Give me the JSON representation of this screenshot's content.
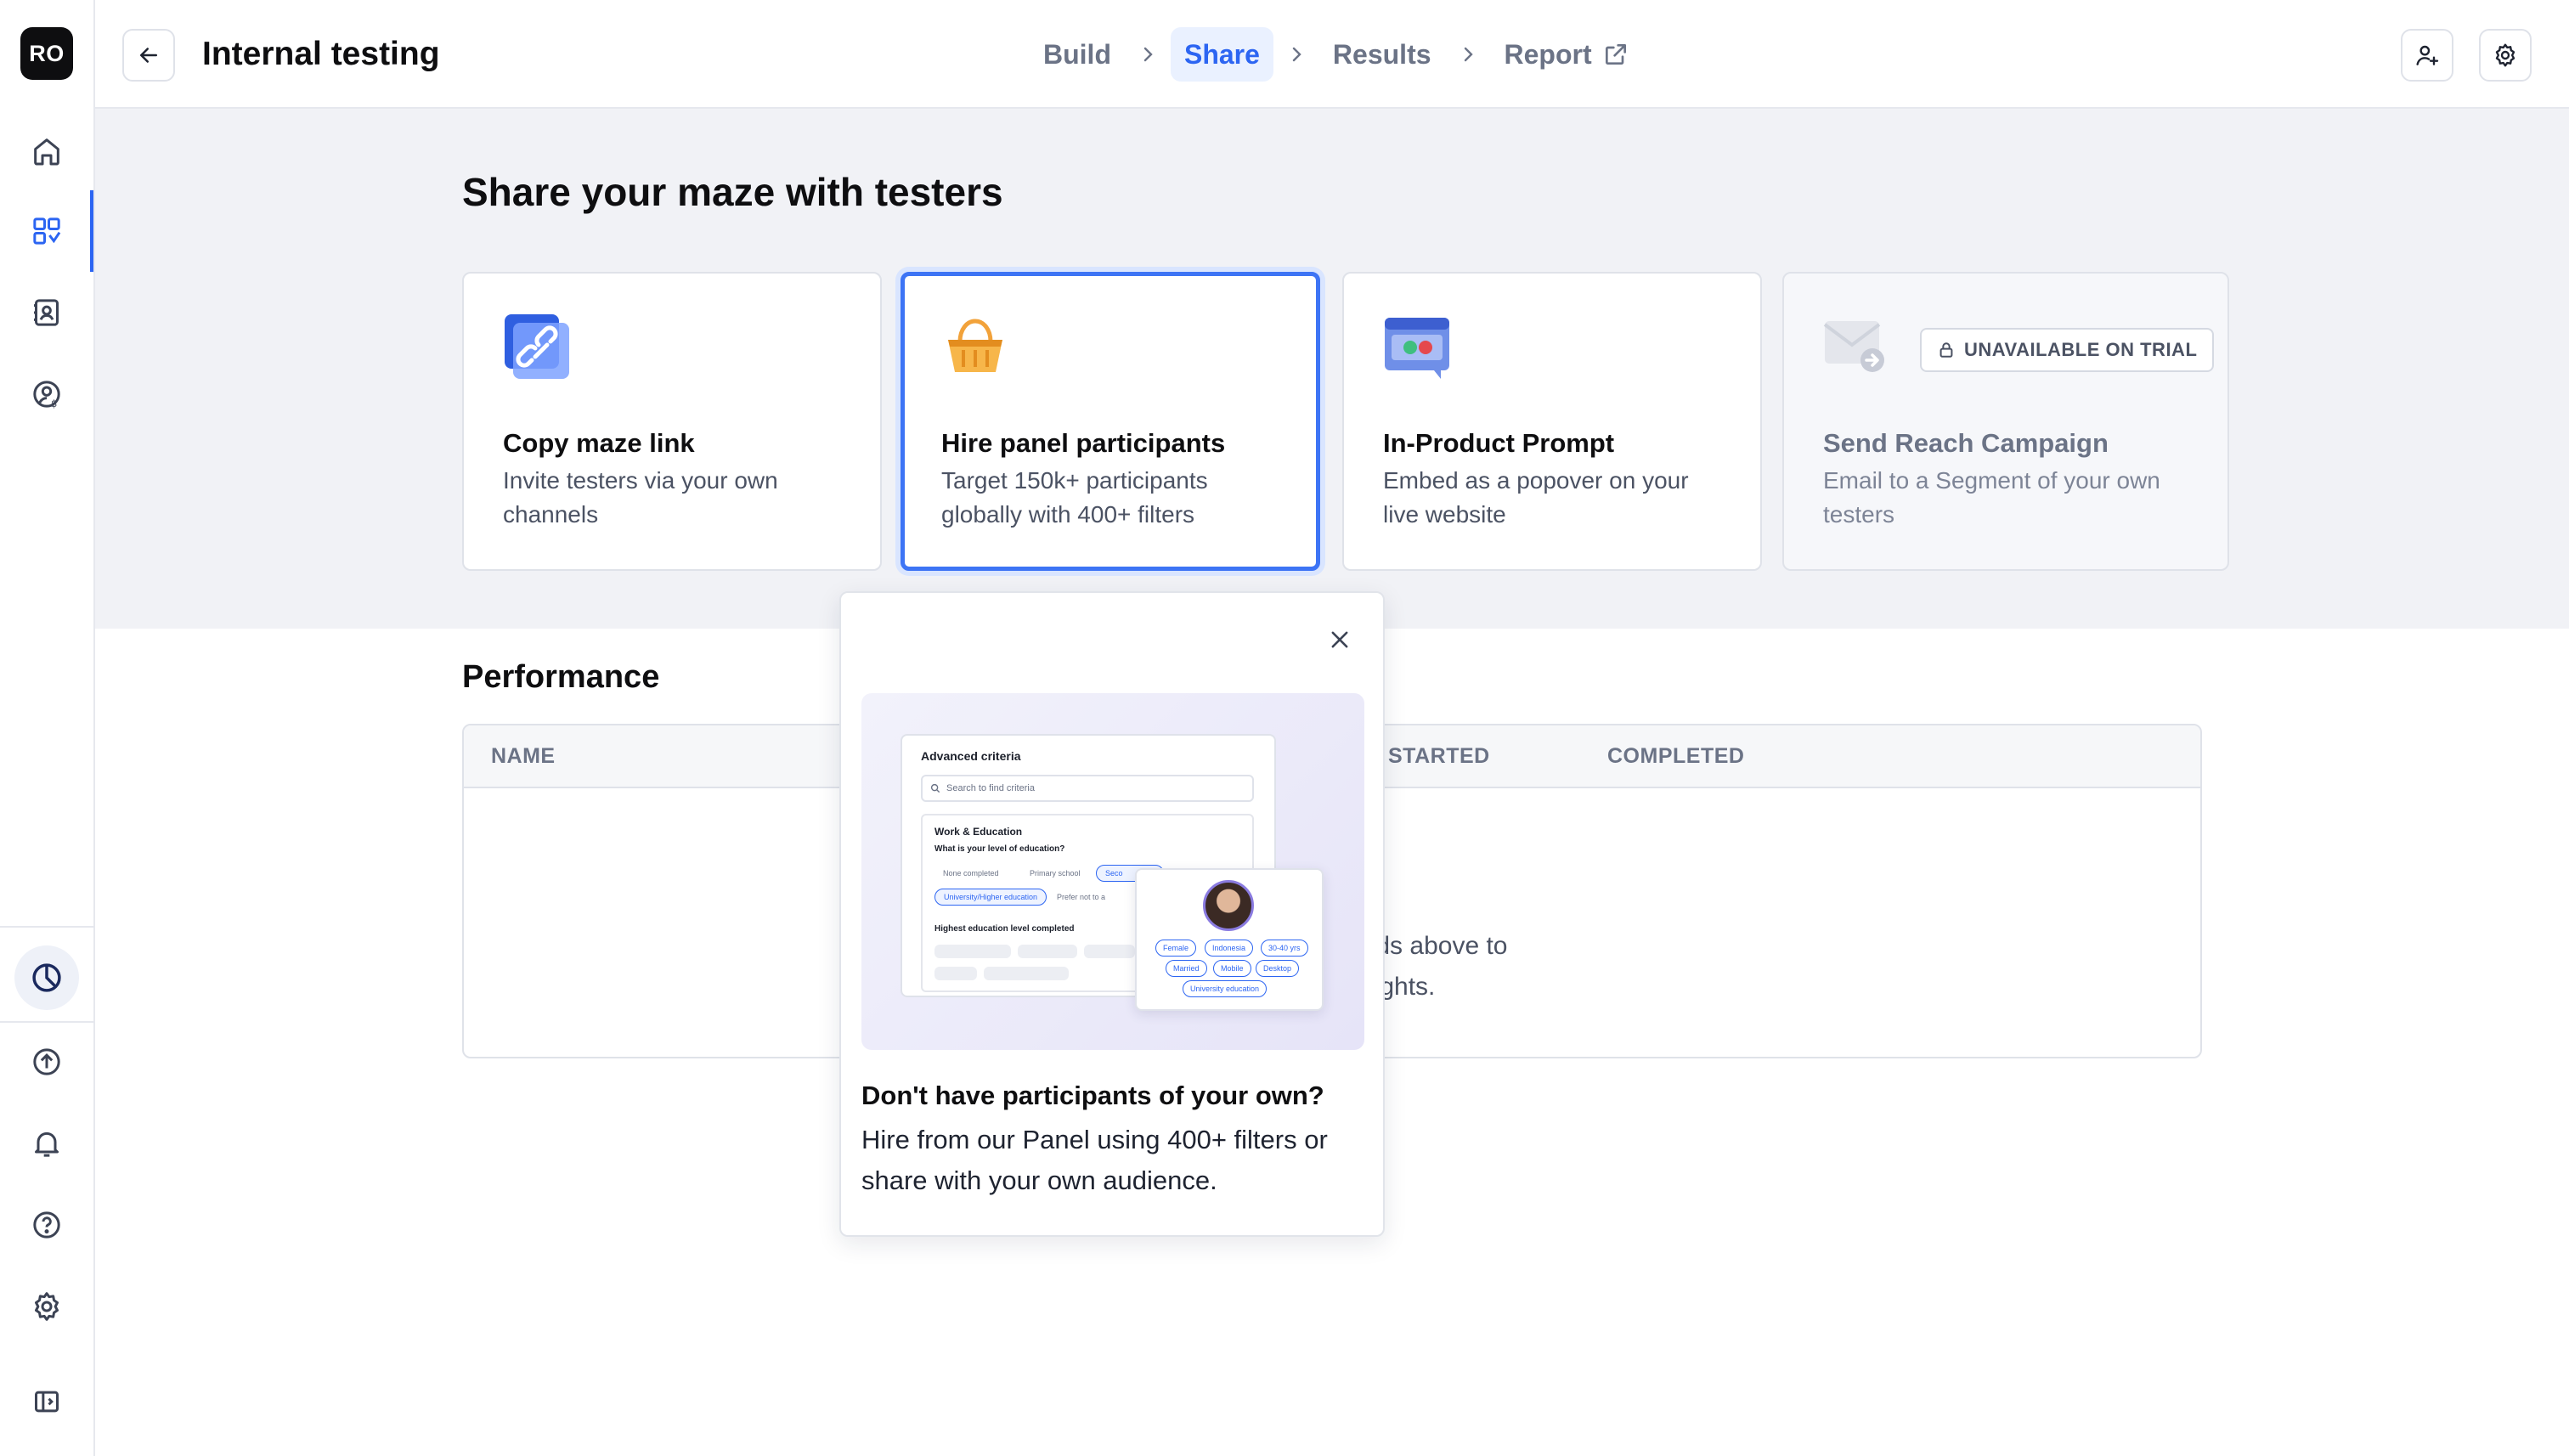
{
  "sidebar": {
    "logo": "RO",
    "icons": [
      "home-icon",
      "mazes-icon",
      "contacts-icon",
      "panel-icon",
      "usage-icon",
      "upgrade-icon",
      "bell-icon",
      "help-icon",
      "settings-icon",
      "collapse-sidebar-icon"
    ],
    "active_item": "mazes-icon"
  },
  "header": {
    "title": "Internal testing",
    "steps": [
      {
        "label": "Build",
        "active": false
      },
      {
        "label": "Share",
        "active": true
      },
      {
        "label": "Results",
        "active": false
      },
      {
        "label": "Report",
        "active": false,
        "external": true
      }
    ]
  },
  "share": {
    "title": "Share your maze with testers",
    "cards": [
      {
        "title": "Copy maze link",
        "description": "Invite testers via your own channels",
        "icon": "link-icon"
      },
      {
        "title": "Hire panel participants",
        "description": "Target 150k+ participants globally with 400+ filters",
        "icon": "basket-icon",
        "selected": true
      },
      {
        "title": "In-Product Prompt",
        "description": "Embed as a popover on your live website",
        "icon": "prompt-icon"
      },
      {
        "title": "Send Reach Campaign",
        "description": "Email to a Segment of your own testers",
        "icon": "email-icon",
        "badge": "UNAVAILABLE ON TRIAL",
        "disabled": true
      }
    ]
  },
  "performance": {
    "title": "Performance",
    "columns": [
      "NAME",
      "STARTED",
      "COMPLETED"
    ],
    "empty_line1": "nods above to",
    "empty_line2": "nsights."
  },
  "popover": {
    "title": "Don't have participants of your own?",
    "body": "Hire from our Panel using 400+ filters or share with your own audience.",
    "illustration": {
      "panel_title": "Advanced criteria",
      "search_placeholder": "Search to find criteria",
      "section_title": "Work & Education",
      "question": "What is your level of education?",
      "chips": [
        "None completed",
        "Primary school",
        "Seco",
        "University/Higher education",
        "Prefer not to a"
      ],
      "question2": "Highest education level completed",
      "tags": [
        "Female",
        "Indonesia",
        "30-40 yrs",
        "Married",
        "Mobile",
        "Desktop",
        "University education"
      ]
    }
  },
  "colors": {
    "accent": "#2c65f2",
    "accent_light": "#eaf1ff",
    "text": "#0e0e10",
    "muted": "#6b7386",
    "section_bg": "#f1f2f6"
  }
}
